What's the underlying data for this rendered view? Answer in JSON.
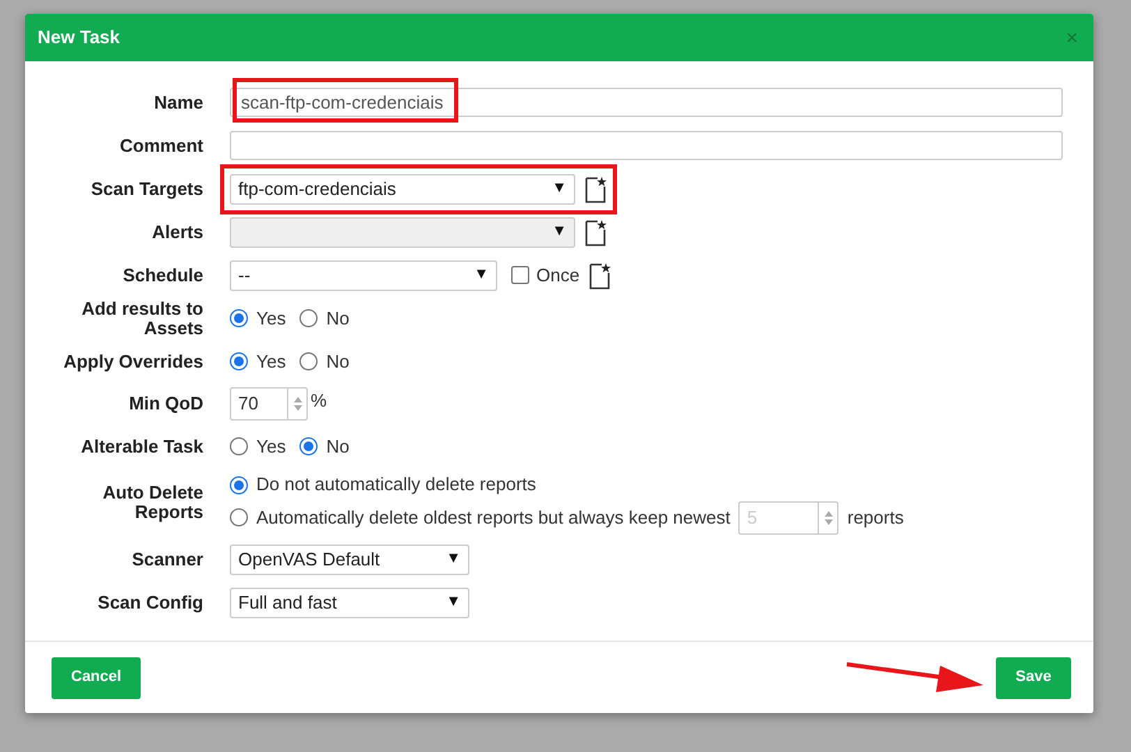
{
  "dialog": {
    "title": "New Task",
    "close": "×"
  },
  "rows": [
    {
      "kind": "text",
      "label": "Name",
      "value": "scan-ftp-com-credenciais",
      "highlighted": true
    },
    {
      "kind": "text",
      "label": "Comment"
    },
    {
      "kind": "select",
      "label": "Scan Targets",
      "value": "ftp-com-credenciais",
      "caret": "▼",
      "disabled": false,
      "new_button": true,
      "highlighted": true
    },
    {
      "kind": "select",
      "label": "Alerts",
      "caret": "▼",
      "disabled": true,
      "new_button": true
    },
    {
      "kind": "select",
      "label": "Schedule",
      "value": "--",
      "caret": "▼",
      "disabled": false,
      "new_button": true,
      "checkbox": {
        "label": "Once",
        "checked": false
      }
    },
    {
      "kind": "radio",
      "label": "Add results to Assets",
      "options": [
        {
          "label": "Yes",
          "selected": true
        },
        {
          "label": "No",
          "selected": false
        }
      ]
    },
    {
      "kind": "radio",
      "label": "Apply Overrides",
      "options": [
        {
          "label": "Yes",
          "selected": true
        },
        {
          "label": "No",
          "selected": false
        }
      ]
    },
    {
      "kind": "spinner",
      "label": "Min QoD",
      "value": "70",
      "unit": "%"
    },
    {
      "kind": "radio",
      "label": "Alterable Task",
      "options": [
        {
          "label": "Yes",
          "selected": false
        },
        {
          "label": "No",
          "selected": true
        }
      ]
    },
    {
      "kind": "autodelete",
      "label": "Auto Delete Reports",
      "options": [
        {
          "label": "Do not automatically delete reports",
          "selected": true
        },
        {
          "label": "Automatically delete oldest reports but always keep newest",
          "selected": false,
          "count": "5",
          "suffix": "reports"
        }
      ]
    },
    {
      "kind": "select",
      "label": "Scanner",
      "value": "OpenVAS Default",
      "caret": "▼",
      "disabled": false
    },
    {
      "kind": "select",
      "label": "Scan Config",
      "value": "Full and fast",
      "caret": "▼",
      "disabled": false
    }
  ],
  "footer": {
    "cancel": "Cancel",
    "save": "Save"
  }
}
